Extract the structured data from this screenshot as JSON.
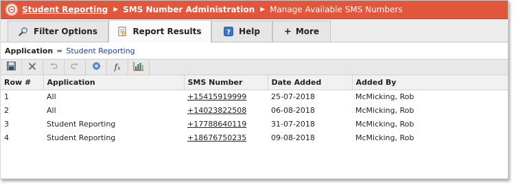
{
  "breadcrumb": {
    "root": "Student Reporting",
    "section": "SMS Number Administration",
    "page": "Manage Available SMS Numbers"
  },
  "tabs": [
    {
      "label": "Filter Options",
      "icon": "magnifier-icon"
    },
    {
      "label": "Report Results",
      "icon": "report-icon"
    },
    {
      "label": "Help",
      "icon": "help-icon"
    },
    {
      "label": "More",
      "icon": "plus-icon"
    }
  ],
  "filter": {
    "label": "Application",
    "operator": "=",
    "value": "Student Reporting"
  },
  "toolbar": [
    "save-icon",
    "delete-icon",
    "undo-icon",
    "redo-icon",
    "settings-icon",
    "formula-icon",
    "chart-icon"
  ],
  "table": {
    "headers": [
      "Row #",
      "Application",
      "SMS Number",
      "Date Added",
      "Added By"
    ],
    "rows": [
      {
        "row": "1",
        "application": "All",
        "sms": "+15415919999",
        "date": "25-07-2018",
        "by": "McMicking, Rob"
      },
      {
        "row": "2",
        "application": "All",
        "sms": "+14023822508",
        "date": "06-08-2018",
        "by": "McMicking, Rob"
      },
      {
        "row": "3",
        "application": "Student Reporting",
        "sms": "+17788640119",
        "date": "31-07-2018",
        "by": "McMicking, Rob"
      },
      {
        "row": "4",
        "application": "Student Reporting",
        "sms": "+18676750235",
        "date": "09-08-2018",
        "by": "McMicking, Rob"
      }
    ]
  },
  "colors": {
    "header_bar": "#e2563c",
    "link_blue": "#1f3fa6"
  }
}
